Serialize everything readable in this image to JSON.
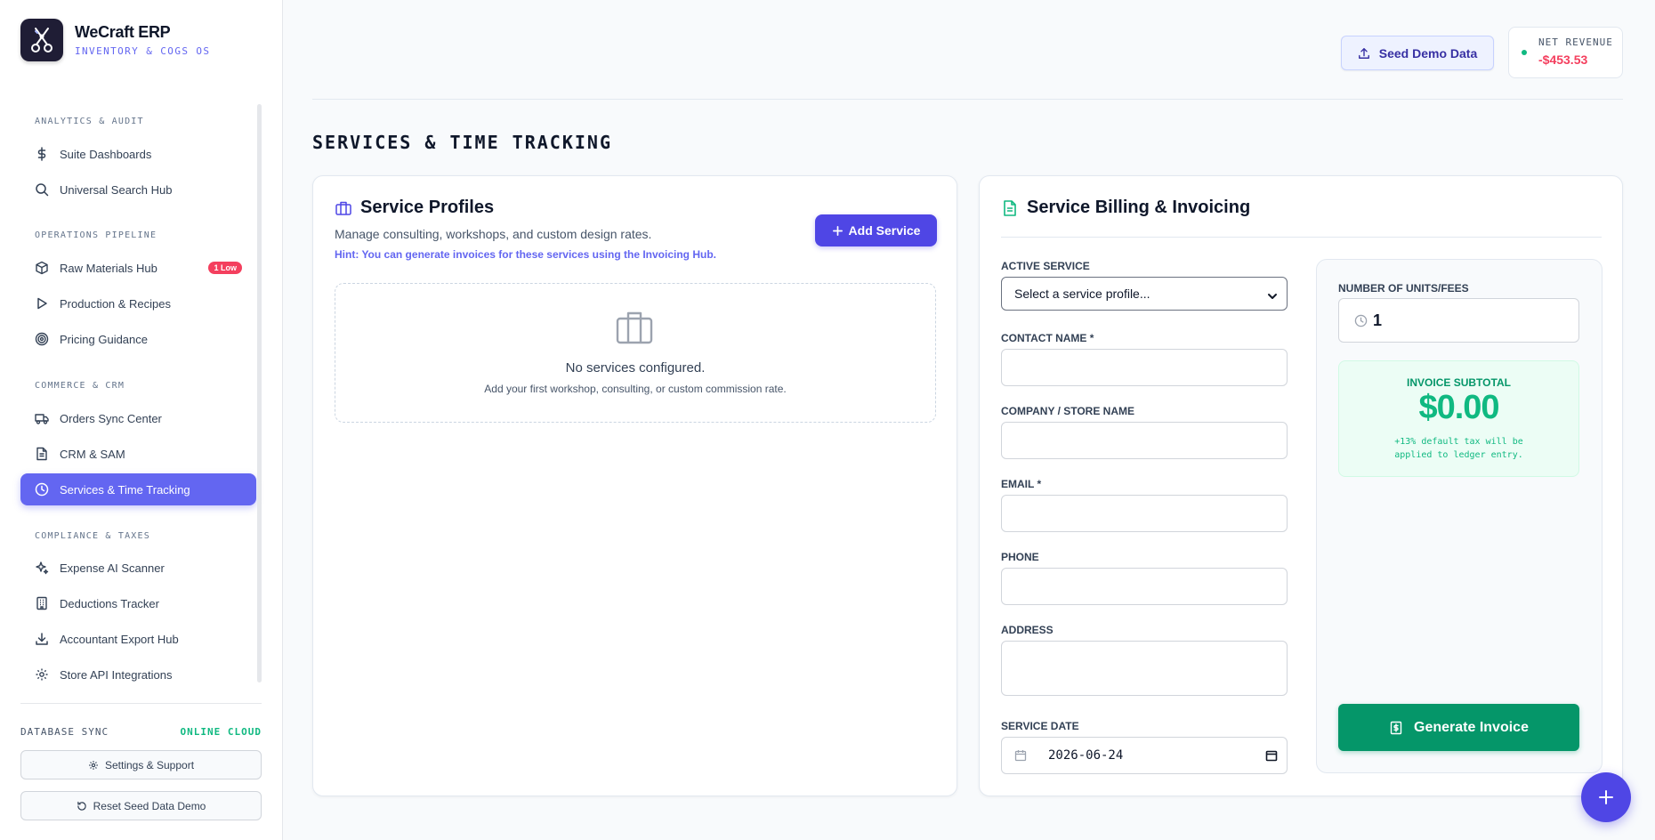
{
  "brand": {
    "title": "WeCraft ERP",
    "subtitle": "INVENTORY & COGS OS"
  },
  "sidebar": {
    "sections": [
      {
        "label": "ANALYTICS & AUDIT"
      },
      {
        "label": "OPERATIONS PIPELINE"
      },
      {
        "label": "COMMERCE & CRM"
      },
      {
        "label": "COMPLIANCE & TAXES"
      }
    ],
    "items": [
      {
        "label": "Suite Dashboards",
        "icon": "dollar-icon"
      },
      {
        "label": "Universal Search Hub",
        "icon": "search-icon"
      },
      {
        "label": "Raw Materials Hub",
        "icon": "cube-icon",
        "badge": "1 Low"
      },
      {
        "label": "Production & Recipes",
        "icon": "play-icon"
      },
      {
        "label": "Pricing Guidance",
        "icon": "target-icon"
      },
      {
        "label": "Orders Sync Center",
        "icon": "truck-icon"
      },
      {
        "label": "CRM & SAM",
        "icon": "document-icon"
      },
      {
        "label": "Services & Time Tracking",
        "icon": "clock-icon",
        "active": true
      },
      {
        "label": "Expense AI Scanner",
        "icon": "sparkle-icon"
      },
      {
        "label": "Deductions Tracker",
        "icon": "building-icon"
      },
      {
        "label": "Accountant Export Hub",
        "icon": "download-icon"
      },
      {
        "label": "Store API Integrations",
        "icon": "gear-icon"
      }
    ],
    "db_sync_label": "DATABASE SYNC",
    "db_sync_status": "ONLINE CLOUD",
    "settings_label": "Settings & Support",
    "reset_label": "Reset Seed Data Demo"
  },
  "header": {
    "seed_label": "Seed Demo Data",
    "revenue_label": "NET REVENUE",
    "revenue_value": "-$453.53"
  },
  "page_title": "SERVICES & TIME TRACKING",
  "profiles": {
    "title": "Service Profiles",
    "description": "Manage consulting, workshops, and custom design rates.",
    "hint": "Hint: You can generate invoices for these services using the Invoicing Hub.",
    "add_label": "Add Service",
    "empty_title": "No services configured.",
    "empty_sub": "Add your first workshop, consulting, or custom commission rate."
  },
  "billing": {
    "title": "Service Billing & Invoicing",
    "active_service_label": "ACTIVE SERVICE",
    "active_service_value": "Select a service profile...",
    "contact_label": "CONTACT NAME *",
    "contact_value": "",
    "company_label": "COMPANY / STORE NAME",
    "company_value": "",
    "email_label": "EMAIL *",
    "email_value": "",
    "phone_label": "PHONE",
    "phone_value": "",
    "address_label": "ADDRESS",
    "address_value": "",
    "date_label": "SERVICE DATE",
    "date_value": "2026-06-24",
    "units_label": "NUMBER OF UNITS/FEES",
    "units_value": "1",
    "subtotal_label": "INVOICE SUBTOTAL",
    "subtotal_value": "$0.00",
    "tax_note_line1": "+13% default tax will be",
    "tax_note_line2": "applied to ledger entry.",
    "generate_label": "Generate Invoice"
  },
  "colors": {
    "accent": "#6366f1",
    "success": "#059669",
    "danger": "#f43f5e"
  }
}
